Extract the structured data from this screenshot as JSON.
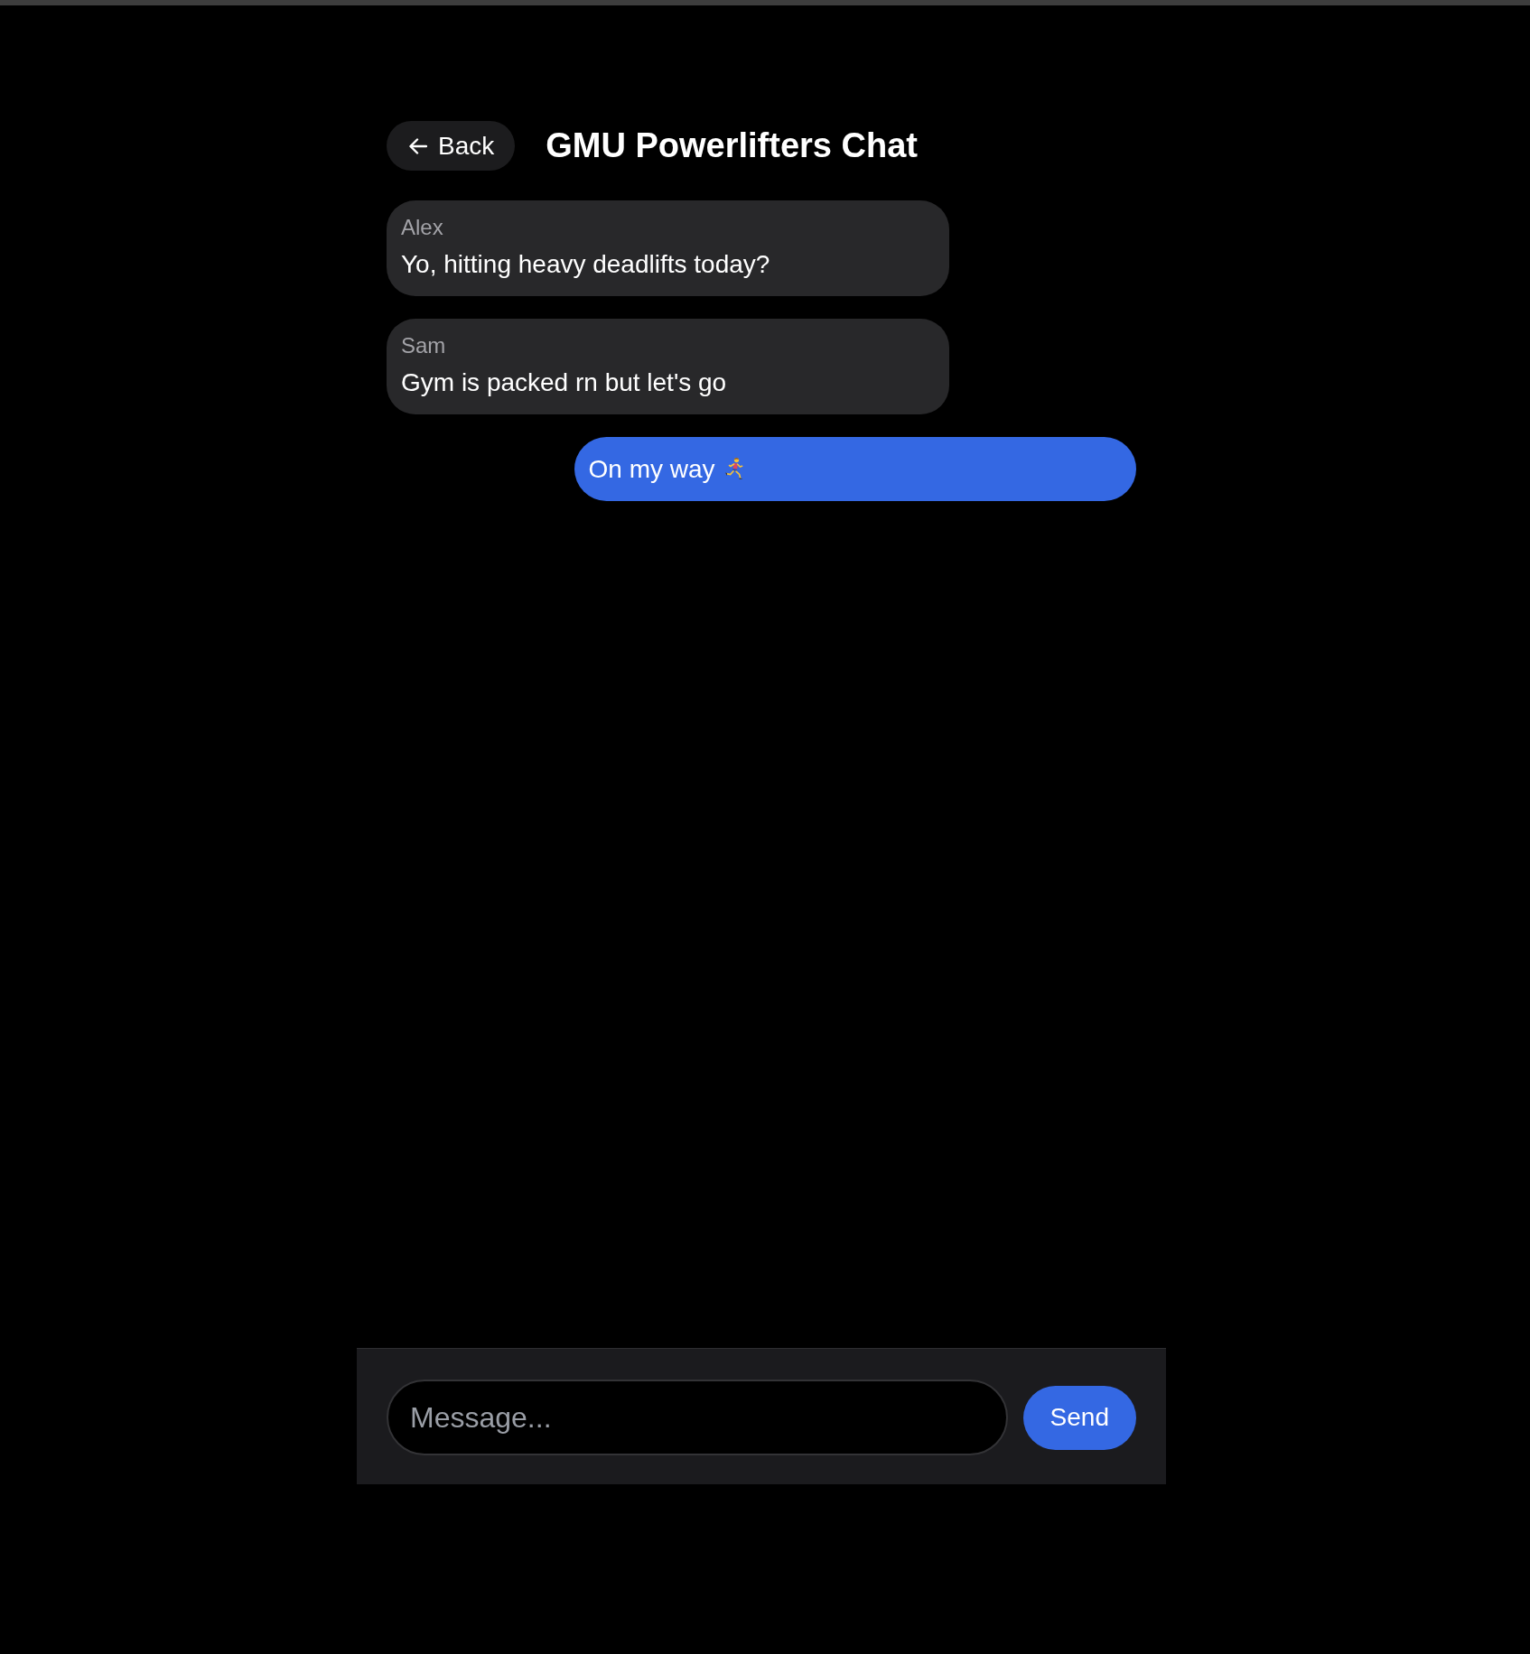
{
  "header": {
    "back_button": {
      "label": "Back"
    },
    "title": "GMU Powerlifters Chat"
  },
  "messages": [
    {
      "kind": "incoming",
      "sender": "Alex",
      "text": "Yo, hitting heavy deadlifts today?",
      "emoji": false
    },
    {
      "kind": "incoming",
      "sender": "Sam",
      "text": "Gym is packed rn but let's go",
      "emoji": false
    },
    {
      "kind": "outgoing",
      "text": "On my way",
      "emoji": true
    }
  ],
  "composer": {
    "placeholder": "Message...",
    "send_button": "Send"
  }
}
